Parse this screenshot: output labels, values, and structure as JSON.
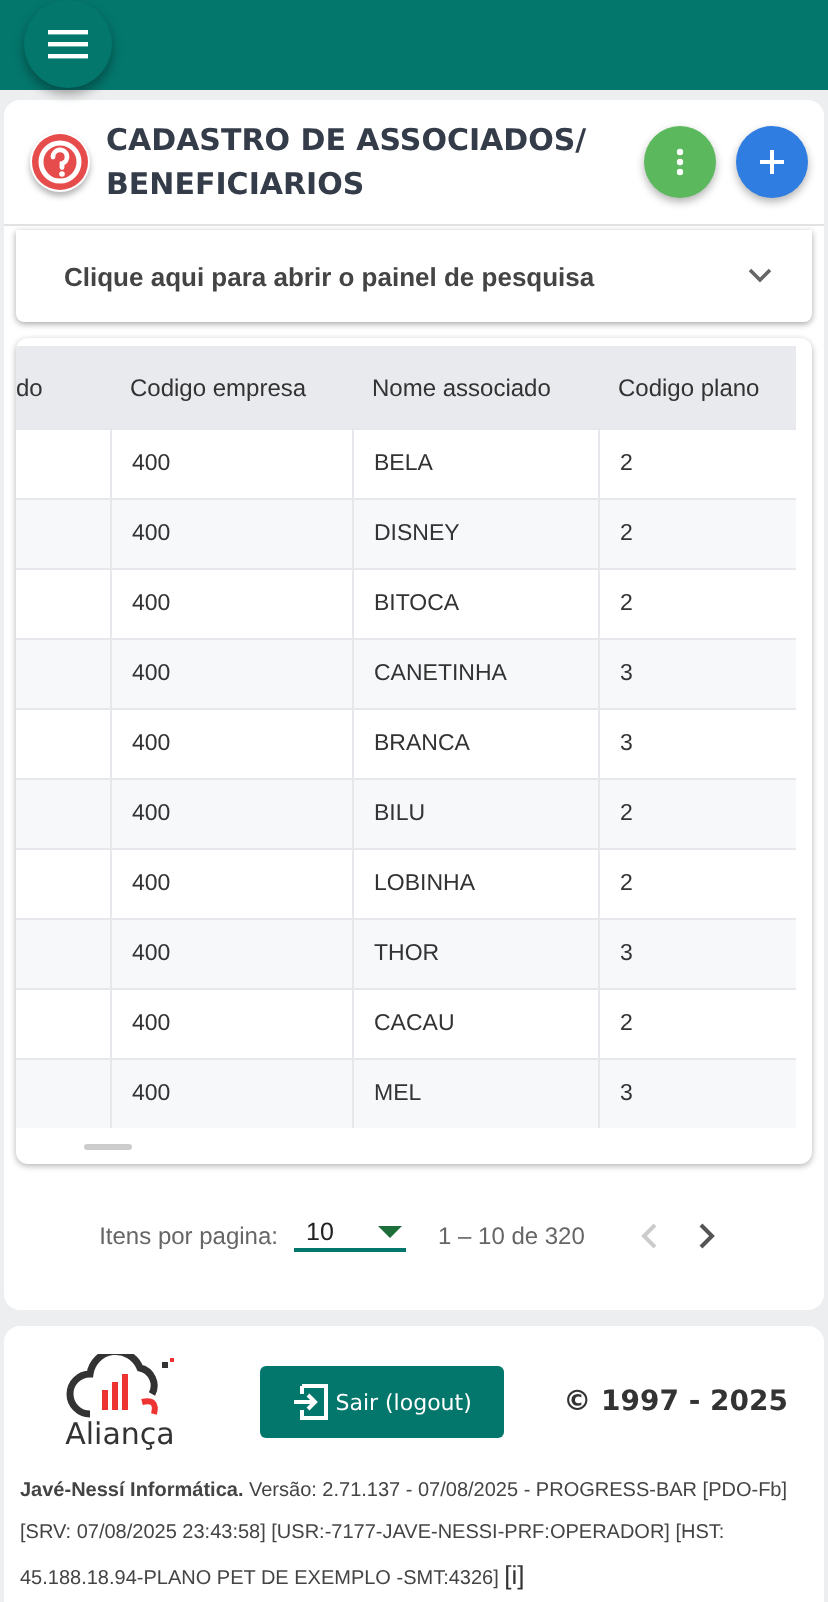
{
  "page_title": "CADASTRO DE ASSOCIADOS/ BENEFICIARIOS",
  "search_panel": {
    "label": "Clique aqui para abrir o painel de pesquisa",
    "expanded": false
  },
  "table": {
    "columns": [
      "do",
      "Codigo empresa",
      "Nome associado",
      "Codigo plano"
    ],
    "rows": [
      [
        "",
        "400",
        "BELA",
        "2"
      ],
      [
        "",
        "400",
        "DISNEY",
        "2"
      ],
      [
        "",
        "400",
        "BITOCA",
        "2"
      ],
      [
        "",
        "400",
        "CANETINHA",
        "3"
      ],
      [
        "",
        "400",
        "BRANCA",
        "3"
      ],
      [
        "",
        "400",
        "BILU",
        "2"
      ],
      [
        "",
        "400",
        "LOBINHA",
        "2"
      ],
      [
        "",
        "400",
        "THOR",
        "3"
      ],
      [
        "",
        "400",
        "CACAU",
        "2"
      ],
      [
        "",
        "400",
        "MEL",
        "3"
      ]
    ]
  },
  "paginator": {
    "label": "Itens por pagina:",
    "page_size": "10",
    "range": "1 – 10 de 320",
    "prev_disabled": true,
    "next_disabled": false
  },
  "footer": {
    "logo_text": "Aliança",
    "logout": "Sair (logout)",
    "copyright": "© 1997 - 2025",
    "info": "**Javé-Nessí Informática.** Versão: 2.71.137 - 07/08/2025 - PROGRESS-BAR [PDO-Fb] [SRV: 07/08/2025 23:43:58] [USR:-7177-JAVE-NESSI-PRF:OPERADOR] [HST: 45.188.18.94-PLANO PET DE EXEMPLO -SMT:4326]",
    "info_link": "[i]"
  }
}
